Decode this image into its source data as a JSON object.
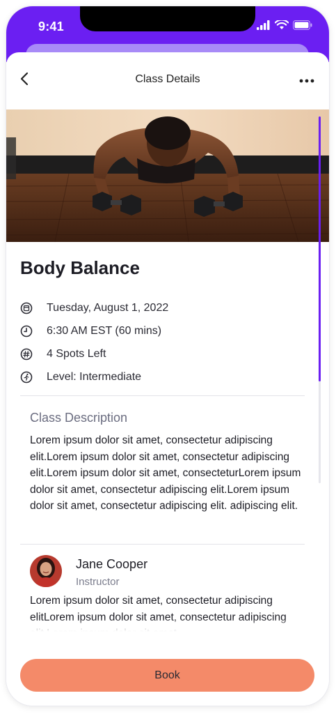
{
  "status_bar": {
    "time": "9:41",
    "icons": [
      "signal-icon",
      "wifi-icon",
      "battery-icon"
    ]
  },
  "header": {
    "title": "Class Details",
    "back_icon": "chevron-left-icon",
    "more_icon": "more-horizontal-icon"
  },
  "class": {
    "name": "Body Balance",
    "meta": [
      {
        "icon": "calendar-icon",
        "text": "Tuesday, August 1, 2022"
      },
      {
        "icon": "clock-icon",
        "text": "6:30 AM EST (60 mins)"
      },
      {
        "icon": "hash-icon",
        "text": "4 Spots Left"
      },
      {
        "icon": "running-icon",
        "text": "Level: Intermediate"
      }
    ],
    "description_title": "Class Description",
    "description": "Lorem ipsum dolor sit amet, consectetur adipiscing elit.Lorem ipsum dolor sit amet, consectetur adipiscing elit.Lorem ipsum dolor sit amet, consecteturLorem ipsum dolor sit amet, consectetur adipiscing elit.Lorem ipsum dolor sit amet, consectetur adipiscing elit. adipiscing elit."
  },
  "instructor": {
    "name": "Jane Cooper",
    "role": "Instructor",
    "bio": "Lorem ipsum dolor sit amet, consectetur adipiscing elitLorem ipsum dolor sit amet, consectetur adipiscing elit.Lorem ipsum dolor sit amet."
  },
  "actions": {
    "book_label": "Book"
  },
  "colors": {
    "brand_purple": "#6b1ff2",
    "sheet_tint": "#a88af7",
    "book_button": "#f48a69"
  }
}
